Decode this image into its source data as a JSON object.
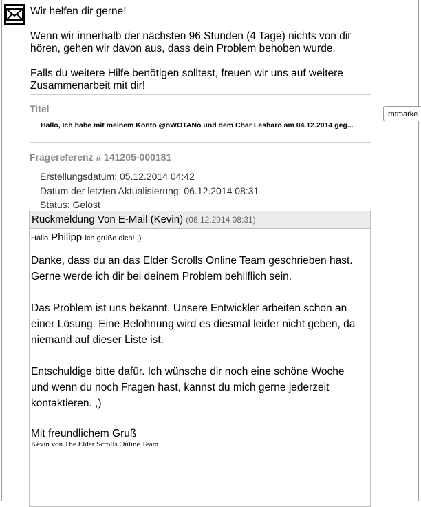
{
  "intro": {
    "heading": "Wir helfen dir gerne!",
    "para1": "Wenn wir innerhalb der nächsten 96 Stunden (4 Tage) nichts von dir hören, gehen wir davon aus, dass dein Problem behoben wurde.",
    "para2": "Falls du weitere Hilfe benötigen solltest, freuen wir uns auf weitere Zusammenarbeit mit dir!"
  },
  "side_tab": {
    "label": "rntmarke"
  },
  "ticket": {
    "title_label": "Titel",
    "title_value": "Hallo, Ich habe mit meinem Konto @oWOTANo und dem Char Lesharo am 04.12.2014 geg...",
    "reference": "Fragereferenz # 141205-000181",
    "created": "Erstellungsdatum: 05.12.2014 04:42",
    "updated": "Datum der letzten Aktualisierung: 06.12.2014 08:31",
    "status": "Status: Gelöst"
  },
  "reply": {
    "header": "Rückmeldung Von E-Mail (Kevin)",
    "timestamp": "(06.12.2014 08:31)",
    "greet_hallo": "Hallo",
    "greet_name": "Philipp",
    "greet_rest": "ich grüße dich! ,)",
    "p1": "Danke, dass du an das Elder Scrolls Online Team geschrieben hast. Gerne werde ich dir bei deinem Problem behilflich sein.",
    "p2": "Das Problem ist uns bekannt. Unsere Entwickler arbeiten schon an einer Lösung. Eine Belohnung wird es diesmal leider nicht geben, da niemand auf dieser Liste ist.",
    "p3": "Entschuldige bitte dafür. Ich wünsche dir noch eine schöne Woche und wenn du noch Fragen hast, kannst du mich gerne jederzeit kontaktieren. ,)",
    "closing": "Mit freundlichem Gruß",
    "signature": "Kevin von The Elder Scrolls Online Team"
  },
  "icons": {
    "mail": "envelope-icon"
  }
}
